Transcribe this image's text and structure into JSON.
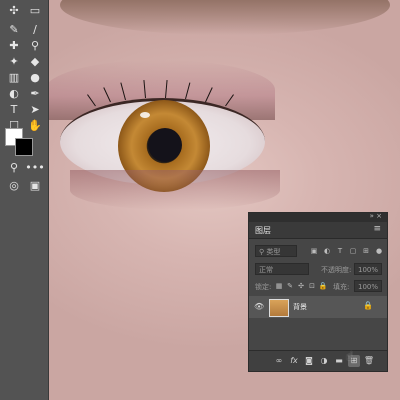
{
  "toolbar": {
    "tools": [
      {
        "name": "move-tool-icon",
        "glyph": "✣"
      },
      {
        "name": "marquee-tool-icon",
        "glyph": "▭"
      },
      {
        "name": "eyedropper-tool-icon",
        "glyph": "✎"
      },
      {
        "name": "brush-tool-icon",
        "glyph": "∕"
      },
      {
        "name": "clone-stamp-tool-icon",
        "glyph": "✚"
      },
      {
        "name": "stamp-tool-icon",
        "glyph": "⚲"
      },
      {
        "name": "history-brush-icon",
        "glyph": "✦"
      },
      {
        "name": "eraser-tool-icon",
        "glyph": "◆"
      },
      {
        "name": "gradient-tool-icon",
        "glyph": "▥"
      },
      {
        "name": "blur-tool-icon",
        "glyph": "●"
      },
      {
        "name": "dodge-tool-icon",
        "glyph": "◐"
      },
      {
        "name": "pen-tool-icon",
        "glyph": "✒"
      },
      {
        "name": "type-tool-icon",
        "glyph": "T"
      },
      {
        "name": "path-select-tool-icon",
        "glyph": "➤"
      },
      {
        "name": "shape-tool-icon",
        "glyph": "☐"
      },
      {
        "name": "hand-tool-icon",
        "glyph": "✋"
      },
      {
        "name": "zoom-tool-icon",
        "glyph": "⚲"
      },
      {
        "name": "more-tools-icon",
        "glyph": "•••"
      }
    ]
  },
  "layers_panel": {
    "title": "图层",
    "kind_label": "类型",
    "blend_mode": "正常",
    "opacity_label": "不透明度:",
    "opacity_value": "100%",
    "lock_label": "锁定:",
    "fill_label": "填充:",
    "fill_value": "100%",
    "layer": {
      "name": "背景"
    },
    "footer_icons": [
      "link-layers-icon",
      "fx-icon",
      "add-mask-icon",
      "adjustment-layer-icon",
      "new-group-icon",
      "new-layer-icon",
      "delete-layer-icon"
    ]
  },
  "colors": {
    "foreground": "#ffffff",
    "background": "#000000",
    "toolbar_bg": "#535353",
    "panel_bg": "#464646"
  }
}
